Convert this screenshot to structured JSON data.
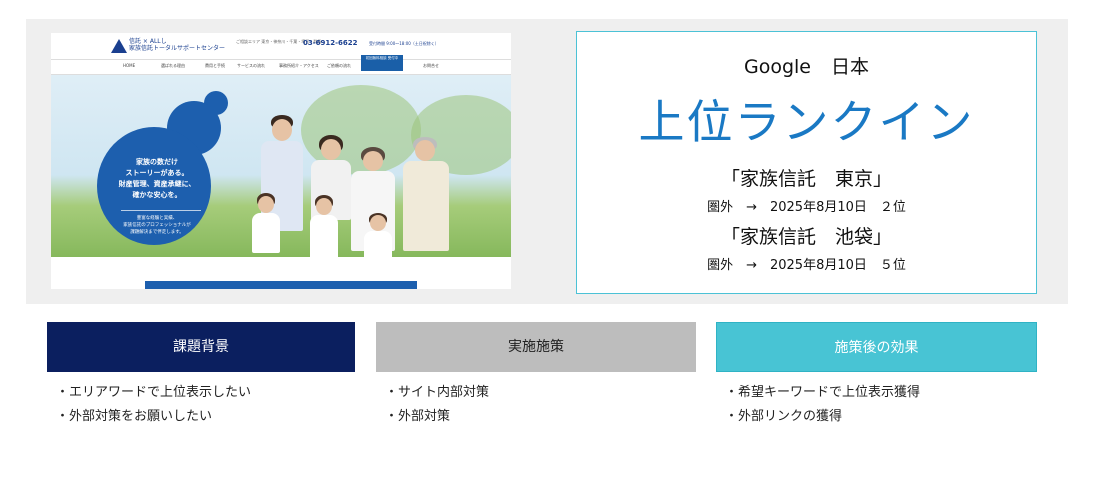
{
  "website_thumbnail": {
    "logo_text_line1": "信託 × ALLし",
    "logo_text_line2": "家族信託トータルサポートセンター",
    "header_meta": "ご相談エリア 東京・神奈川・千葉・埼玉・群馬",
    "phone": "03-6912-6622",
    "hours": "受付時間 9:00～18:00（土日祝除く）",
    "nav": [
      "HOME",
      "選ばれる理由",
      "費用と手続",
      "サービスの流れ",
      "事務所紹介・アクセス",
      "ご依頼の流れ",
      "お問合せ"
    ],
    "nav_cta": "初回無料相談 受付中",
    "hero_copy": "家族の数だけ\nストーリーがある。\n財産管理、資産承継に、\n確かな安心を。",
    "hero_sub": "豊富な経験と実績、\n家族信託のプロフェッショナルが\n課題解決まで伴走します。"
  },
  "ranking": {
    "engine": "Google",
    "region": "日本",
    "headline": "上位ランクイン",
    "keywords": [
      {
        "keyword": "「家族信託　東京」",
        "result": "圏外　→　2025年8月10日　２位"
      },
      {
        "keyword": "「家族信託　池袋」",
        "result": "圏外　→　2025年8月10日　５位"
      }
    ]
  },
  "columns": [
    {
      "title": "課題背景",
      "items": [
        "・エリアワードで上位表示したい",
        "・外部対策をお願いしたい"
      ],
      "color": "#0b1f5f"
    },
    {
      "title": "実施施策",
      "items": [
        "・サイト内部対策",
        "・外部対策"
      ],
      "color": "#bdbdbd"
    },
    {
      "title": "施策後の効果",
      "items": [
        "・希望キーワードで上位表示獲得",
        "・外部リンクの獲得"
      ],
      "color": "#48c4d4"
    }
  ]
}
